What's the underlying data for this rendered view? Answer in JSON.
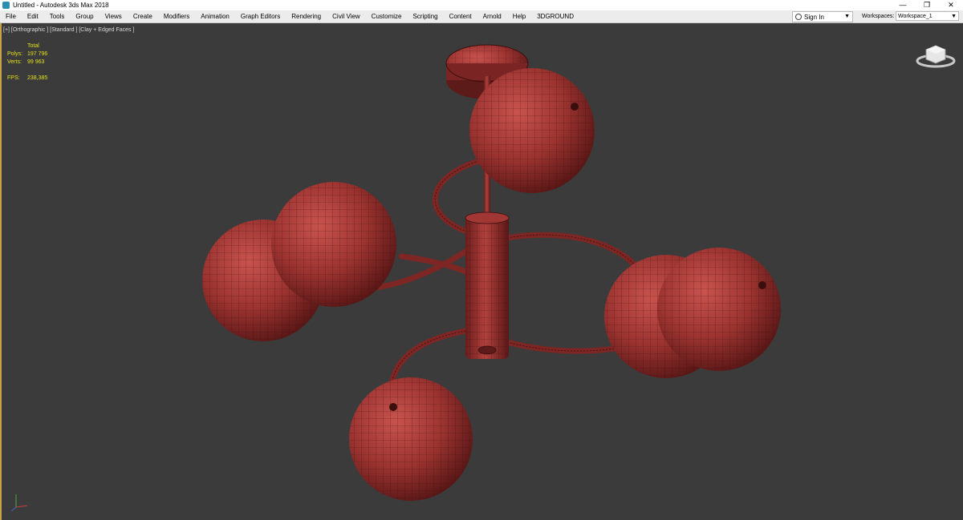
{
  "window": {
    "title": "Untitled - Autodesk 3ds Max 2018",
    "minimize": "—",
    "restore": "❐",
    "close": "✕"
  },
  "menu": [
    "File",
    "Edit",
    "Tools",
    "Group",
    "Views",
    "Create",
    "Modifiers",
    "Animation",
    "Graph Editors",
    "Rendering",
    "Civil View",
    "Customize",
    "Scripting",
    "Content",
    "Arnold",
    "Help",
    "3DGROUND"
  ],
  "signin": {
    "label": "Sign In"
  },
  "workspaces": {
    "label": "Workspaces:",
    "value": "Workspace_1"
  },
  "viewport": {
    "label": "[+] [Orthographic ] [Standard ] [Clay + Edged Faces ]",
    "stats": {
      "header": "Total",
      "polys_label": "Polys:",
      "polys": "197 796",
      "verts_label": "Verts:",
      "verts": "99 963",
      "fps_label": "FPS:",
      "fps": "238,385"
    }
  },
  "colors": {
    "accent": "#c7a34a",
    "mesh": "#9b3330",
    "wire": "#3a0f0e",
    "stats": "#e3e01b",
    "viewport_bg": "#3b3b3b"
  },
  "icons": [
    "app-icon",
    "user-icon",
    "viewcube-icon",
    "axis-gizmo-icon"
  ]
}
